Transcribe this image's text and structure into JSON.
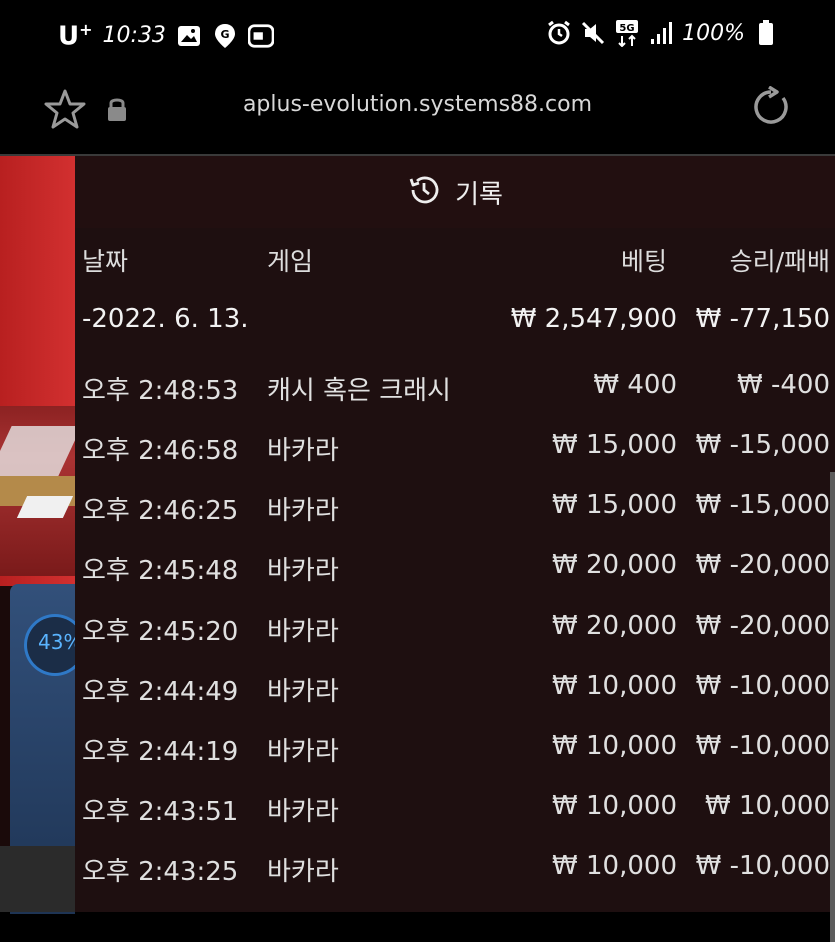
{
  "status_bar": {
    "carrier": "U",
    "carrier_sup": "+",
    "time": "10:33",
    "battery": "100%",
    "network": "5G"
  },
  "browser": {
    "url": "aplus-evolution.systems88.com"
  },
  "game": {
    "progress_percent": "43%"
  },
  "history": {
    "title": "기록",
    "columns": {
      "date": "날짜",
      "game": "게임",
      "bet": "베팅",
      "win_loss": "승리/패배"
    },
    "summary": {
      "date": "-2022. 6. 13.",
      "bet": "₩ 2,547,900",
      "win_loss": "₩ -77,150"
    },
    "rows": [
      {
        "time": "오후 2:48:53",
        "game": "캐시 혹은 크래시",
        "bet": "₩ 400",
        "win_loss": "₩ -400"
      },
      {
        "time": "오후 2:46:58",
        "game": "바카라",
        "bet": "₩ 15,000",
        "win_loss": "₩ -15,000"
      },
      {
        "time": "오후 2:46:25",
        "game": "바카라",
        "bet": "₩ 15,000",
        "win_loss": "₩ -15,000"
      },
      {
        "time": "오후 2:45:48",
        "game": "바카라",
        "bet": "₩ 20,000",
        "win_loss": "₩ -20,000"
      },
      {
        "time": "오후 2:45:20",
        "game": "바카라",
        "bet": "₩ 20,000",
        "win_loss": "₩ -20,000"
      },
      {
        "time": "오후 2:44:49",
        "game": "바카라",
        "bet": "₩ 10,000",
        "win_loss": "₩ -10,000"
      },
      {
        "time": "오후 2:44:19",
        "game": "바카라",
        "bet": "₩ 10,000",
        "win_loss": "₩ -10,000"
      },
      {
        "time": "오후 2:43:51",
        "game": "바카라",
        "bet": "₩ 10,000",
        "win_loss": "₩ 10,000"
      },
      {
        "time": "오후 2:43:25",
        "game": "바카라",
        "bet": "₩ 10,000",
        "win_loss": "₩ -10,000"
      }
    ]
  },
  "colors": {
    "panel_bg": "#1e0f10",
    "text": "#e0e0e0",
    "accent_blue": "#5ab4ff"
  }
}
